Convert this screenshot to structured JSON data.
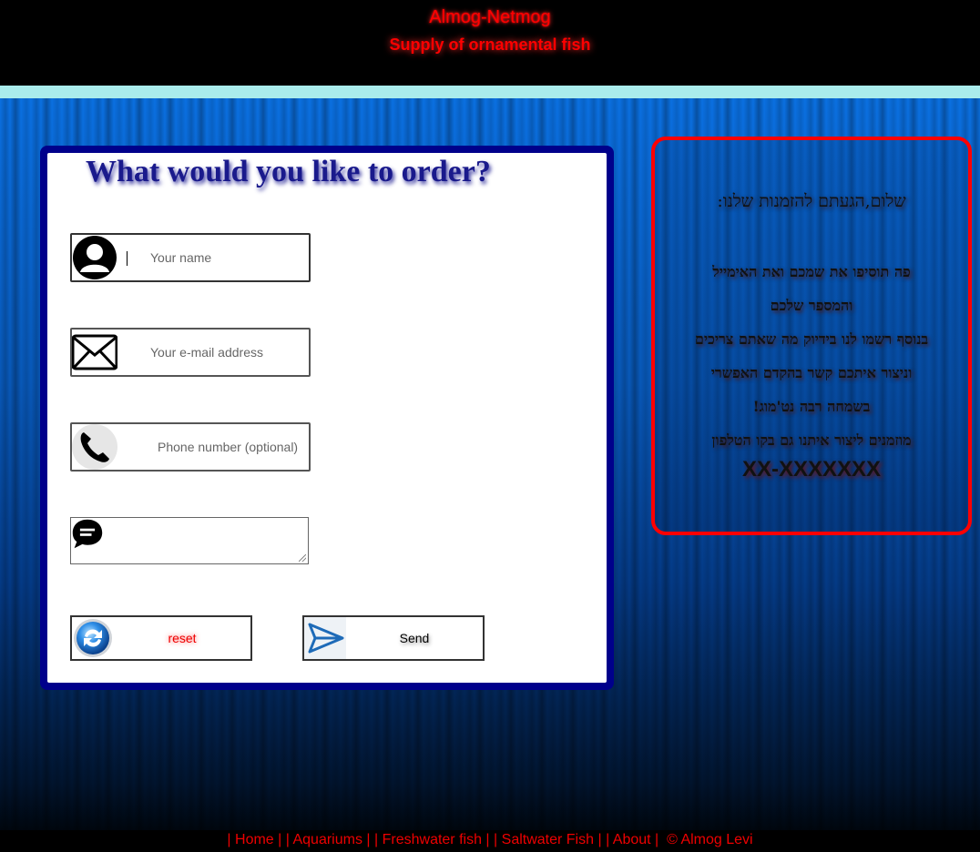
{
  "header": {
    "brand": "Almog-Netmog",
    "tagline": "Supply of ornamental fish"
  },
  "form": {
    "title": "What would you like to order?",
    "name_placeholder": "Your name",
    "email_placeholder": "Your e-mail address",
    "phone_placeholder": "Phone number (optional)",
    "reset_label": "reset",
    "send_label": "Send",
    "icons": [
      "user-avatar-icon",
      "envelope-icon",
      "phone-icon",
      "chat-bubble-icon",
      "refresh-icon",
      "send-icon"
    ]
  },
  "info": {
    "greeting": "שלום,הגעתם להזמנות שלנו:",
    "lines": [
      "פה תוסיפו את שמכם ואת האימייל",
      "והמספר שלכם",
      "בנוסף רשמו לנו בידיוק מה שאתם צריכים",
      "וניצור איתכם קשר בהקדם האפשרי",
      "בשמחה רבה נט'מוג!",
      "מוזמנים ליצור איתנו גם בקו הטלפון"
    ],
    "phone": "XX-XXXXXXX"
  },
  "footer": {
    "links": [
      "Home",
      "Aquariums",
      "Freshwater fish",
      "Saltwater Fish",
      "About"
    ],
    "copyright": "© Almog Levi"
  },
  "colors": {
    "accent_red": "#ff0000",
    "panel_navy": "#00008b",
    "strip_cyan": "#a9ecec"
  }
}
